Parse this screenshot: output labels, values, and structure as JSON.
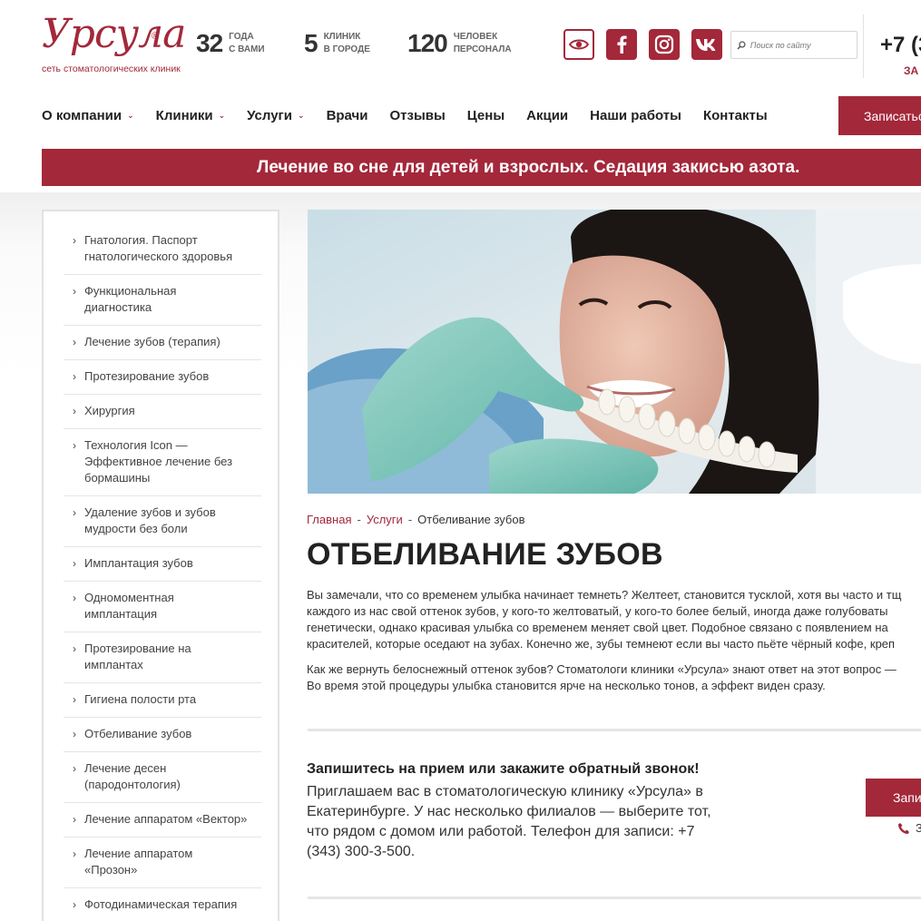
{
  "header": {
    "logo_text": "Урсула",
    "logo_reg": "®",
    "logo_sub": "сеть стоматологических клиник",
    "stats": [
      {
        "num": "32",
        "label": "ГОДА\nС ВАМИ"
      },
      {
        "num": "5",
        "label": "КЛИНИК\nВ ГОРОДЕ"
      },
      {
        "num": "120",
        "label": "ЧЕЛОВЕК\nПЕРСОНАЛА"
      }
    ],
    "search_placeholder": "Поиск по сайту",
    "phone": "+7 (3",
    "phone_sub": "ЗА"
  },
  "nav": {
    "items": [
      {
        "label": "О компании",
        "dropdown": true
      },
      {
        "label": "Клиники",
        "dropdown": true
      },
      {
        "label": "Услуги",
        "dropdown": true
      },
      {
        "label": "Врачи",
        "dropdown": false
      },
      {
        "label": "Отзывы",
        "dropdown": false
      },
      {
        "label": "Цены",
        "dropdown": false
      },
      {
        "label": "Акции",
        "dropdown": false
      },
      {
        "label": "Наши работы",
        "dropdown": false
      },
      {
        "label": "Контакты",
        "dropdown": false
      }
    ],
    "cta": "Записаться"
  },
  "banner": "Лечение во сне для детей и взрослых. Седация закисью азота.",
  "sidebar": {
    "items": [
      {
        "label": "Гнатология. Паспорт\nгнатологического здоровья"
      },
      {
        "label": "Функциональная\nдиагностика"
      },
      {
        "label": "Лечение зубов (терапия)"
      },
      {
        "label": "Протезирование зубов"
      },
      {
        "label": "Хирургия"
      },
      {
        "label": "Технология Icon —\nЭффективное лечение без\nбормашины"
      },
      {
        "label": "Удаление зубов и зубов\nмудрости без боли"
      },
      {
        "label": "Имплантация зубов"
      },
      {
        "label": "Одномоментная\nимплантация"
      },
      {
        "label": "Протезирование на\nимплантах"
      },
      {
        "label": "Гигиена полости рта"
      },
      {
        "label": "Отбеливание зубов"
      },
      {
        "label": "Лечение десен\n(пародонтология)"
      },
      {
        "label": "Лечение аппаратом «Вектор»"
      },
      {
        "label": "Лечение аппаратом\n«Прозон»"
      },
      {
        "label": "Фотодинамическая терапия"
      }
    ]
  },
  "breadcrumb": {
    "home": "Главная",
    "sep": "-",
    "services": "Услуги",
    "current": "Отбеливание зубов"
  },
  "page_title": "ОТБЕЛИВАНИЕ ЗУБОВ",
  "intro_lines": [
    "Вы замечали, что со временем улыбка начинает темнеть? Желтеет, становится тусклой, хотя вы часто и тщ",
    "каждого из нас свой оттенок зубов, у кого-то желтоватый, у кого-то более белый, иногда даже голубоваты",
    "генетически, однако красивая улыбка со временем меняет свой цвет. Подобное связано с появлением на",
    "красителей, которые оседают на зубах. Конечно же, зубы темнеют если вы часто пьёте чёрный кофе, креп"
  ],
  "second_lines": [
    "Как же вернуть белоснежный оттенок зубов? Стоматологи клиники «Урсула» знают ответ на этот вопрос —",
    "Во время этой процедуры улыбка становится ярче на несколько тонов, а эффект виден сразу."
  ],
  "cta_block": {
    "title": "Запишитесь на прием или закажите обратный звонок!",
    "lines": [
      "Приглашаем вас в стоматологическую клинику «Урсула» в",
      "Екатеринбурге. У нас несколько филиалов — выберите тот,",
      "что рядом с домом или работой. Телефон для записи: +7",
      "(343) 300-3-500."
    ],
    "button": "Запи",
    "phone": "З"
  },
  "colors": {
    "brand": "#a3283a",
    "text": "#222222"
  }
}
